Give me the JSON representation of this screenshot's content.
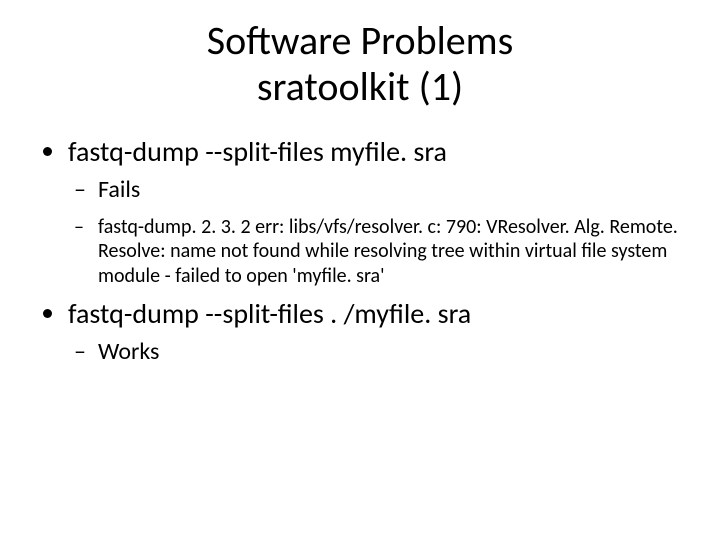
{
  "title_line1": "Software Problems",
  "title_line2": "sratoolkit (1)",
  "items": [
    {
      "text": "fastq-dump --split-files myfile. sra",
      "sub": [
        {
          "text": "Fails",
          "sub": []
        },
        {
          "text": "fastq-dump. 2. 3. 2 err: libs/vfs/resolver. c: 790: VResolver. Alg. Remote. Resolve: name not found while resolving tree within virtual file system module - failed to open 'myfile. sra'",
          "sub": [],
          "level": 3
        }
      ]
    },
    {
      "text": "fastq-dump --split-files . /myfile. sra",
      "sub": [
        {
          "text": "Works",
          "sub": []
        }
      ]
    }
  ]
}
